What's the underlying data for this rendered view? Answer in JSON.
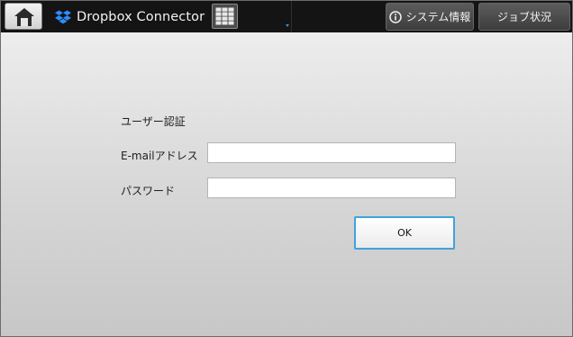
{
  "header": {
    "home_icon": "home-icon",
    "app_icon": "dropbox-icon",
    "app_title": "Dropbox Connector",
    "keypad_icon": "keypad-icon",
    "system_info_icon": "info-icon",
    "system_info_label": "システム情報",
    "job_status_label": "ジョブ状況",
    "accent_color": "#41a3dc",
    "dropbox_color": "#2d8cff"
  },
  "auth_form": {
    "section_title": "ユーザー認証",
    "email_label": "E-mailアドレス",
    "email_value": "",
    "password_label": "パスワード",
    "password_value": "",
    "ok_label": "OK"
  }
}
